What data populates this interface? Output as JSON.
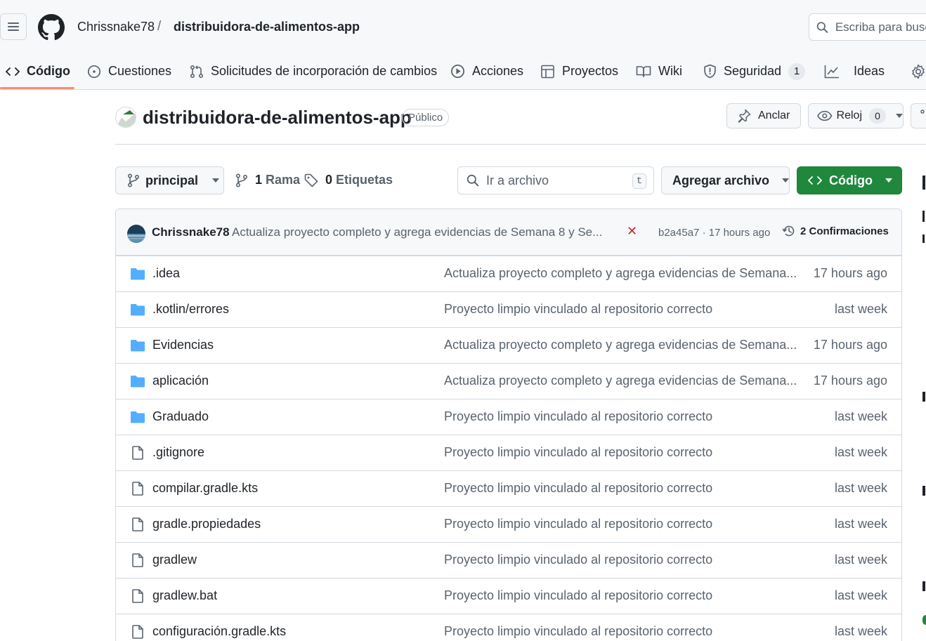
{
  "header": {
    "owner": "Chrissnake78",
    "separator": "/",
    "repo": "distribuidora-de-alimentos-app",
    "search_placeholder": "Escriba para buscar"
  },
  "nav": {
    "tabs": [
      {
        "label": "Código",
        "icon": "code-icon",
        "selected": true
      },
      {
        "label": "Cuestiones",
        "icon": "issue-opened-icon"
      },
      {
        "label": "Solicitudes de incorporación de cambios",
        "icon": "git-pull-request-icon"
      },
      {
        "label": "Acciones",
        "icon": "play-icon"
      },
      {
        "label": "Proyectos",
        "icon": "table-icon"
      },
      {
        "label": "Wiki",
        "icon": "book-icon"
      },
      {
        "label": "Seguridad",
        "icon": "shield-icon",
        "counter": "1"
      },
      {
        "label": "Ideas",
        "icon": "graph-icon"
      }
    ]
  },
  "repo": {
    "title": "distribuidora-de-alimentos-app",
    "visibility": "Público",
    "pin_label": "Anclar",
    "watch_label": "Reloj",
    "watch_count": "0"
  },
  "filenav": {
    "branch": "principal",
    "branches_count": "1",
    "branches_label": "Rama",
    "tags_count": "0",
    "tags_label": "Etiquetas",
    "gofile_placeholder": "Ir a archivo",
    "gofile_shortcut": "t",
    "add_file_label": "Agregar archivo",
    "code_button_label": "Código"
  },
  "latest_commit": {
    "author": "Chrissnake78",
    "message": "Actualiza proyecto completo y agrega evidencias de Semana 8 y Se...",
    "status": "✕",
    "sha_time": "b2a45a7 · 17 hours ago",
    "history": "2 Confirmaciones"
  },
  "files": [
    {
      "name": ".idea",
      "type": "folder",
      "message": "Actualiza proyecto completo y agrega evidencias de Semana...",
      "age": "17 hours ago"
    },
    {
      "name": ".kotlin/errores",
      "type": "folder",
      "message": "Proyecto limpio vinculado al repositorio correcto",
      "age": "last week"
    },
    {
      "name": "Evidencias",
      "type": "folder",
      "message": "Actualiza proyecto completo y agrega evidencias de Semana...",
      "age": "17 hours ago"
    },
    {
      "name": "aplicación",
      "type": "folder",
      "message": "Actualiza proyecto completo y agrega evidencias de Semana...",
      "age": "17 hours ago"
    },
    {
      "name": "Graduado",
      "type": "folder",
      "message": "Proyecto limpio vinculado al repositorio correcto",
      "age": "last week"
    },
    {
      "name": ".gitignore",
      "type": "file",
      "message": "Proyecto limpio vinculado al repositorio correcto",
      "age": "last week"
    },
    {
      "name": "compilar.gradle.kts",
      "type": "file",
      "message": "Proyecto limpio vinculado al repositorio correcto",
      "age": "last week"
    },
    {
      "name": "gradle.propiedades",
      "type": "file",
      "message": "Proyecto limpio vinculado al repositorio correcto",
      "age": "last week"
    },
    {
      "name": "gradlew",
      "type": "file",
      "message": "Proyecto limpio vinculado al repositorio correcto",
      "age": "last week"
    },
    {
      "name": "gradlew.bat",
      "type": "file",
      "message": "Proyecto limpio vinculado al repositorio correcto",
      "age": "last week"
    },
    {
      "name": "configuración.gradle.kts",
      "type": "file",
      "message": "Proyecto limpio vinculado al repositorio correcto",
      "age": "last week"
    }
  ],
  "colors": {
    "accent_tab_underline": "#fd8c73",
    "primary_button": "#1f883d",
    "folder": "#54aeff",
    "fail": "#d1242f"
  }
}
